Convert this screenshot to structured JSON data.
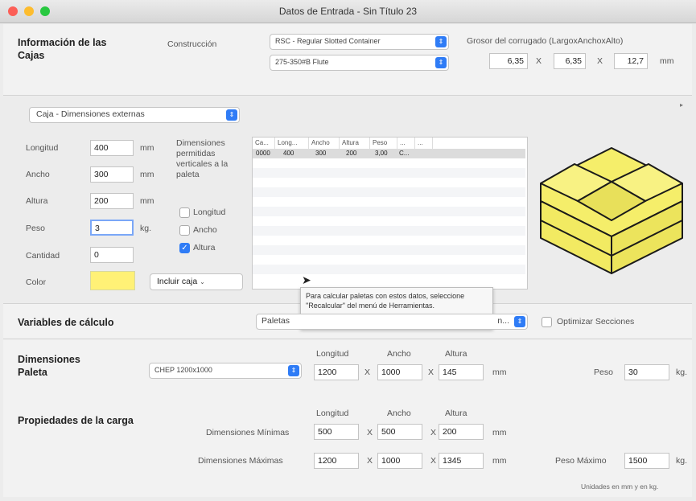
{
  "window": {
    "title": "Datos de Entrada - Sin Título 23"
  },
  "box_info": {
    "heading": "Información de las Cajas",
    "construction_label": "Construcción",
    "construction_value": "RSC - Regular Slotted Container",
    "flute_value": "275-350#B Flute",
    "corrugated_label": "Grosor del corrugado (LargoxAnchoxAlto)",
    "thickness": [
      "6,35",
      "6,35",
      "12,7"
    ],
    "x_sep": "X",
    "unit_mm": "mm"
  },
  "box": {
    "type_value": "Caja - Dimensiones externas",
    "fields": [
      {
        "label": "Longitud",
        "value": "400",
        "unit": "mm"
      },
      {
        "label": "Ancho",
        "value": "300",
        "unit": "mm"
      },
      {
        "label": "Altura",
        "value": "200",
        "unit": "mm"
      },
      {
        "label": "Peso",
        "value": "3",
        "unit": "kg."
      },
      {
        "label": "Cantidad",
        "value": "0",
        "unit": ""
      }
    ],
    "color_label": "Color",
    "color_value": "#fff176",
    "allowed_label": "Dimensiones permitidas verticales a la paleta",
    "allowed": [
      {
        "label": "Longitud",
        "checked": false
      },
      {
        "label": "Ancho",
        "checked": false
      },
      {
        "label": "Altura",
        "checked": true
      }
    ],
    "include_button": "Incluir caja"
  },
  "table": {
    "columns": [
      "Ca...",
      "Long...",
      "Ancho",
      "Altura",
      "Peso",
      "...",
      "..."
    ],
    "rows": [
      [
        "0000",
        "400",
        "300",
        "200",
        "3,00",
        "C..."
      ]
    ]
  },
  "tooltip": {
    "text": "Para calcular paletas con estos datos, seleccione \"Recalcular\" del menú de Herramientas."
  },
  "calc": {
    "heading": "Variables de cálculo",
    "select_value": "Paletas",
    "select_tail": "n...",
    "optimize_label": "Optimizar Secciones"
  },
  "pallet": {
    "heading": "Dimensiones Paleta",
    "select_value": "CHEP 1200x1000",
    "col_labels": [
      "Longitud",
      "Ancho",
      "Altura"
    ],
    "values": [
      "1200",
      "1000",
      "145"
    ],
    "unit": "mm",
    "weight_label": "Peso",
    "weight_value": "30",
    "weight_unit": "kg."
  },
  "load": {
    "heading": "Propiedades de la carga",
    "col_labels": [
      "Longitud",
      "Ancho",
      "Altura"
    ],
    "min_label": "Dimensiones Mínimas",
    "min_values": [
      "500",
      "500",
      "200"
    ],
    "max_label": "Dimensiones Máximas",
    "max_values": [
      "1200",
      "1000",
      "1345"
    ],
    "unit": "mm",
    "maxweight_label": "Peso Máximo",
    "maxweight_value": "1500",
    "maxweight_unit": "kg.",
    "footnote": "Unidades en mm y en kg."
  }
}
